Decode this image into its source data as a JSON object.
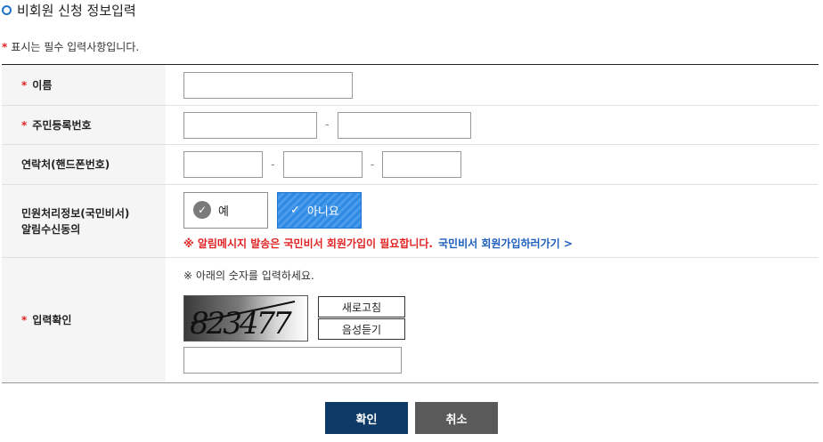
{
  "section": {
    "title": "비회원 신청 정보입력"
  },
  "required_note": {
    "star": "*",
    "text": "표시는 필수 입력사항입니다."
  },
  "form": {
    "name_label": "이름",
    "rrn_label": "주민등록번호",
    "phone_label": "연락처(핸드폰번호)",
    "agree_label_line1": "민원처리정보(국민비서)",
    "agree_label_line2": "알림수신동의",
    "captcha_label": "입력확인",
    "dash": "-",
    "required_star": "*"
  },
  "agree": {
    "yes_label": "예",
    "no_label": "아니요",
    "selected": "아니요",
    "notice": "※ 알림메시지 발송은 국민비서 회원가입이 필요합니다.",
    "join_link": "국민비서 회원가입하러가기 >"
  },
  "captcha": {
    "guide": "※ 아래의 숫자를 입력하세요.",
    "code": "823477",
    "refresh_label": "새로고침",
    "audio_label": "음성듣기"
  },
  "buttons": {
    "confirm": "확인",
    "cancel": "취소"
  },
  "colors": {
    "accent": "#1e73c9",
    "required": "#e02424",
    "confirm_bg": "#0d3a66",
    "cancel_bg": "#5a5a5a",
    "selected_choice": "#2f8ae3"
  }
}
